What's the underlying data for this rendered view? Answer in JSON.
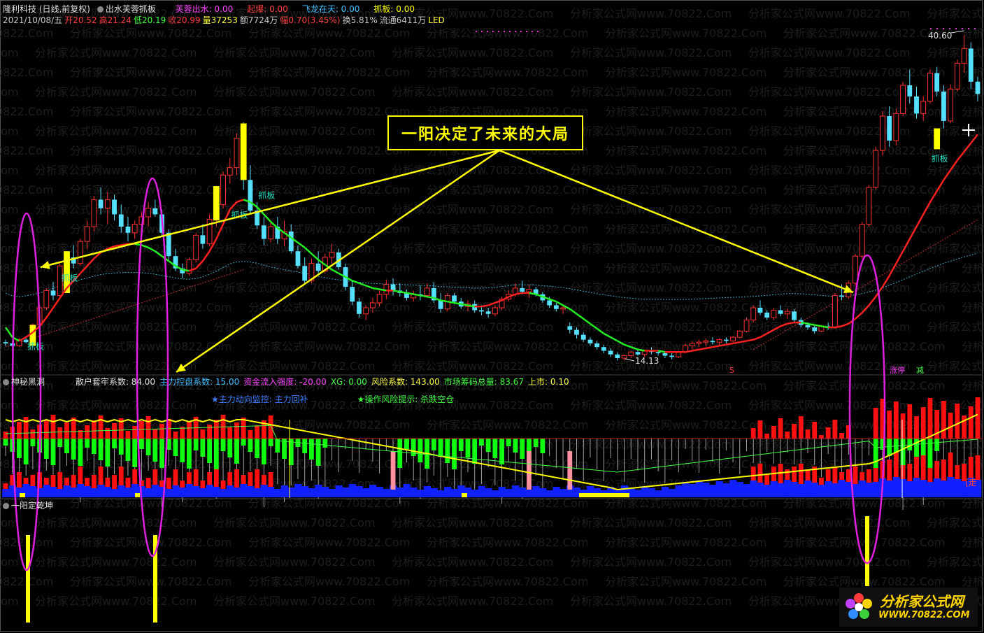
{
  "header": {
    "stock": "隆利科技 (日线,前复权)",
    "indicator": "出水芙蓉抓板",
    "signals": [
      {
        "label": "芙蓉出水: 0.00",
        "color": "#ff44ff"
      },
      {
        "label": "起爆: 0.00",
        "color": "#ff4040"
      },
      {
        "label": "飞龙在天: 0.00",
        "color": "#40c0ff"
      },
      {
        "label": "抓板: 0.00",
        "color": "#ffff00"
      }
    ],
    "quote": [
      {
        "label": "2021/10/08/五",
        "color": "#c8c8c8"
      },
      {
        "label": "开20.52",
        "color": "#ff4040"
      },
      {
        "label": "高21.24",
        "color": "#ff4040"
      },
      {
        "label": "低20.19",
        "color": "#40ff40"
      },
      {
        "label": "收20.99",
        "color": "#ff4040"
      },
      {
        "label": "量37253",
        "color": "#ffff40"
      },
      {
        "label": "额7724万",
        "color": "#c8c8c8"
      },
      {
        "label": "幅0.70(3.45%)",
        "color": "#ff4040"
      },
      {
        "label": "换5.81%",
        "color": "#c8c8c8"
      },
      {
        "label": "流通6411万",
        "color": "#c8c8c8"
      },
      {
        "label": "LED",
        "color": "#ffff40"
      }
    ]
  },
  "main_chart": {
    "high_label": "40.60",
    "low_label": "14.13",
    "zhuaban_label": "抓板",
    "callout": "一阳决定了未来的大局",
    "marker_s": "S",
    "marker_a": "涨停",
    "marker_b": "减"
  },
  "panel2": {
    "title": "神秘黑洞",
    "row1": [
      {
        "label": "散户套牢系数: 84.00",
        "color": "#e0e0e0"
      },
      {
        "label": "主力控盘系数: 15.00",
        "color": "#40c0ff"
      },
      {
        "label": "资金流入强度: -20.00",
        "color": "#ff44ff"
      },
      {
        "label": "XG: 0.00",
        "color": "#40ff40"
      },
      {
        "label": "风险系数: 143.00",
        "color": "#ffff40"
      },
      {
        "label": "市场筹码总量: 83.67",
        "color": "#40ff40"
      },
      {
        "label": "上市: 0.10",
        "color": "#ffff40"
      }
    ],
    "row2": [
      {
        "label": "★主力动向监控: 主力回补",
        "color": "#4080ff"
      },
      {
        "label": "★操作风险提示: 杀跌空仓",
        "color": "#40ff40"
      }
    ],
    "right_tag": "[走"
  },
  "panel3": {
    "title": "一阳定乾坤"
  },
  "watermark": "分析家公式网www.70822.Com",
  "logo": {
    "name": "分析家公式网",
    "url": "WWW.70822.COM"
  },
  "chart_data": {
    "type": "candlestick",
    "title": "隆利科技 (日线,前复权)",
    "ylim": [
      14.13,
      40.6
    ],
    "candles": [
      [
        15.6,
        15.8,
        15.3,
        15.5
      ],
      [
        15.5,
        15.7,
        15.2,
        15.3
      ],
      [
        15.3,
        15.9,
        15.2,
        15.8
      ],
      [
        15.8,
        16.0,
        15.5,
        15.6
      ],
      [
        15.6,
        17.1,
        15.5,
        17.0
      ],
      [
        17.0,
        18.6,
        16.8,
        18.4
      ],
      [
        18.4,
        20.0,
        18.2,
        19.8
      ],
      [
        19.8,
        20.5,
        19.0,
        19.4
      ],
      [
        19.4,
        22.0,
        19.2,
        21.8
      ],
      [
        21.8,
        23.0,
        21.0,
        22.5
      ],
      [
        22.5,
        23.5,
        21.6,
        22.0
      ],
      [
        22.0,
        24.0,
        21.8,
        23.8
      ],
      [
        23.8,
        25.5,
        23.2,
        25.0
      ],
      [
        25.0,
        27.5,
        24.6,
        27.2
      ],
      [
        27.2,
        28.2,
        26.0,
        26.5
      ],
      [
        26.5,
        27.8,
        25.2,
        27.2
      ],
      [
        27.2,
        27.6,
        25.5,
        26.0
      ],
      [
        26.0,
        26.8,
        24.5,
        25.0
      ],
      [
        25.0,
        25.8,
        23.8,
        24.5
      ],
      [
        24.5,
        25.5,
        24.0,
        25.2
      ],
      [
        25.2,
        26.2,
        24.8,
        25.8
      ],
      [
        25.8,
        27.0,
        25.0,
        26.5
      ],
      [
        26.5,
        27.2,
        25.8,
        26.0
      ],
      [
        26.0,
        26.4,
        24.2,
        24.5
      ],
      [
        24.5,
        24.8,
        22.3,
        22.6
      ],
      [
        22.6,
        23.2,
        21.4,
        21.6
      ],
      [
        21.6,
        22.0,
        20.8,
        21.2
      ],
      [
        21.2,
        22.5,
        21.0,
        22.3
      ],
      [
        22.3,
        24.5,
        22.1,
        24.3
      ],
      [
        24.3,
        25.2,
        23.2,
        23.6
      ],
      [
        23.6,
        26.0,
        23.4,
        25.6
      ],
      [
        25.6,
        27.2,
        25.0,
        26.8
      ],
      [
        26.8,
        29.5,
        26.5,
        29.2
      ],
      [
        29.2,
        30.6,
        28.5,
        29.8
      ],
      [
        29.8,
        32.6,
        29.2,
        32.2
      ],
      [
        32.2,
        33.5,
        28.0,
        28.8
      ],
      [
        28.8,
        30.0,
        26.0,
        26.3
      ],
      [
        26.3,
        27.0,
        24.8,
        25.1
      ],
      [
        25.1,
        25.8,
        23.5,
        24.0
      ],
      [
        24.0,
        25.4,
        23.7,
        25.0
      ],
      [
        25.0,
        25.8,
        23.6,
        24.0
      ],
      [
        24.0,
        25.5,
        23.4,
        24.6
      ],
      [
        24.6,
        25.2,
        22.8,
        23.0
      ],
      [
        23.0,
        23.5,
        21.6,
        21.8
      ],
      [
        21.8,
        22.5,
        20.4,
        20.6
      ],
      [
        20.6,
        22.4,
        20.4,
        22.0
      ],
      [
        22.0,
        23.0,
        21.2,
        21.4
      ],
      [
        21.4,
        22.8,
        21.2,
        22.5
      ],
      [
        22.5,
        23.6,
        22.0,
        22.9
      ],
      [
        22.9,
        23.2,
        21.5,
        21.7
      ],
      [
        21.7,
        22.0,
        19.8,
        20.1
      ],
      [
        20.1,
        20.6,
        18.6,
        18.9
      ],
      [
        18.9,
        19.2,
        17.6,
        17.9
      ],
      [
        17.9,
        18.6,
        17.4,
        18.4
      ],
      [
        18.4,
        19.2,
        18.0,
        18.8
      ],
      [
        18.8,
        19.9,
        18.5,
        19.5
      ],
      [
        19.5,
        20.7,
        19.1,
        20.3
      ],
      [
        20.3,
        20.8,
        19.4,
        19.8
      ],
      [
        19.8,
        20.4,
        19.3,
        19.6
      ],
      [
        19.6,
        19.9,
        19.0,
        19.2
      ],
      [
        19.2,
        19.8,
        18.9,
        19.5
      ],
      [
        19.5,
        20.2,
        19.0,
        19.4
      ],
      [
        19.4,
        20.4,
        19.2,
        20.0
      ],
      [
        20.0,
        20.5,
        18.8,
        19.0
      ],
      [
        19.0,
        19.6,
        18.0,
        18.3
      ],
      [
        18.3,
        19.6,
        18.1,
        19.4
      ],
      [
        19.4,
        19.6,
        18.7,
        18.9
      ],
      [
        18.9,
        19.2,
        18.3,
        18.5
      ],
      [
        18.5,
        19.0,
        18.1,
        18.7
      ],
      [
        18.7,
        19.0,
        18.0,
        18.2
      ],
      [
        18.2,
        18.6,
        17.8,
        18.1
      ],
      [
        18.1,
        18.4,
        17.6,
        17.9
      ],
      [
        17.9,
        18.6,
        17.7,
        18.4
      ],
      [
        18.4,
        19.3,
        18.2,
        19.1
      ],
      [
        19.1,
        19.8,
        18.9,
        19.5
      ],
      [
        19.5,
        20.4,
        19.3,
        20.0
      ],
      [
        20.0,
        20.6,
        19.5,
        19.7
      ],
      [
        19.7,
        20.3,
        19.2,
        19.9
      ],
      [
        19.9,
        20.1,
        19.3,
        19.5
      ],
      [
        19.5,
        19.7,
        18.8,
        19.0
      ],
      [
        19.0,
        19.3,
        18.4,
        18.6
      ],
      [
        18.6,
        18.8,
        18.1,
        18.3
      ],
      [
        18.3,
        18.7,
        17.9,
        18.4
      ],
      [
        16.9,
        17.2,
        16.3,
        16.6
      ],
      [
        16.6,
        16.8,
        15.9,
        16.2
      ],
      [
        16.2,
        16.4,
        15.6,
        15.8
      ],
      [
        15.8,
        16.0,
        15.3,
        15.5
      ],
      [
        15.5,
        15.7,
        15.0,
        15.2
      ],
      [
        15.2,
        15.4,
        14.7,
        14.9
      ],
      [
        14.9,
        15.1,
        14.4,
        14.6
      ],
      [
        14.6,
        14.8,
        14.1,
        14.3
      ],
      [
        14.3,
        14.6,
        14.13,
        14.5
      ],
      [
        14.5,
        14.9,
        14.3,
        14.8
      ],
      [
        14.8,
        15.1,
        14.5,
        14.6
      ],
      [
        14.6,
        15.0,
        14.4,
        14.9
      ],
      [
        14.9,
        15.2,
        14.6,
        14.8
      ],
      [
        14.8,
        14.9,
        14.5,
        14.7
      ],
      [
        14.7,
        14.8,
        14.3,
        14.5
      ],
      [
        14.5,
        14.7,
        14.2,
        14.4
      ],
      [
        14.4,
        14.9,
        14.3,
        14.8
      ],
      [
        14.8,
        15.5,
        14.7,
        15.3
      ],
      [
        15.3,
        15.7,
        15.0,
        15.5
      ],
      [
        15.5,
        15.8,
        15.2,
        15.6
      ],
      [
        15.6,
        15.9,
        15.3,
        15.7
      ],
      [
        15.7,
        16.0,
        15.4,
        15.6
      ],
      [
        15.6,
        15.9,
        15.3,
        15.8
      ],
      [
        15.8,
        16.0,
        15.5,
        15.7
      ],
      [
        15.7,
        16.1,
        15.6,
        16.0
      ],
      [
        16.0,
        16.6,
        15.9,
        16.5
      ],
      [
        16.5,
        17.6,
        16.4,
        17.4
      ],
      [
        17.4,
        18.6,
        17.2,
        18.4
      ],
      [
        18.4,
        19.0,
        17.8,
        18.0
      ],
      [
        18.0,
        18.2,
        17.4,
        17.6
      ],
      [
        17.6,
        18.4,
        17.4,
        18.2
      ],
      [
        18.2,
        18.6,
        17.7,
        17.9
      ],
      [
        17.9,
        18.3,
        17.5,
        18.1
      ],
      [
        18.1,
        18.3,
        17.2,
        17.4
      ],
      [
        17.4,
        17.6,
        16.8,
        17.0
      ],
      [
        17.0,
        17.2,
        16.6,
        16.8
      ],
      [
        16.8,
        17.0,
        16.3,
        16.5
      ],
      [
        16.5,
        17.0,
        16.4,
        16.9
      ],
      [
        16.9,
        17.2,
        16.6,
        16.8
      ],
      [
        16.8,
        19.6,
        16.7,
        19.4
      ],
      [
        19.4,
        20.3,
        19.0,
        19.3
      ],
      [
        19.3,
        20.6,
        19.1,
        20.4
      ],
      [
        20.4,
        22.8,
        20.2,
        22.6
      ],
      [
        22.6,
        25.4,
        22.4,
        25.2
      ],
      [
        25.2,
        28.4,
        25.0,
        28.2
      ],
      [
        28.2,
        31.5,
        28.0,
        31.2
      ],
      [
        31.2,
        34.4,
        30.8,
        34.0
      ],
      [
        34.0,
        34.8,
        31.5,
        32.0
      ],
      [
        32.0,
        34.6,
        31.6,
        34.2
      ],
      [
        34.2,
        36.8,
        34.0,
        36.5
      ],
      [
        36.5,
        37.8,
        35.0,
        35.6
      ],
      [
        35.6,
        36.4,
        33.8,
        34.2
      ],
      [
        34.2,
        35.6,
        33.6,
        35.2
      ],
      [
        35.2,
        37.8,
        35.0,
        37.5
      ],
      [
        37.5,
        38.0,
        35.6,
        36.0
      ],
      [
        36.0,
        36.5,
        33.0,
        33.6
      ],
      [
        33.6,
        36.6,
        33.4,
        36.2
      ],
      [
        36.2,
        38.6,
        36.0,
        38.3
      ],
      [
        38.3,
        40.6,
        37.5,
        39.5
      ],
      [
        39.5,
        40.0,
        36.2,
        36.8
      ],
      [
        36.8,
        37.2,
        35.2,
        35.8
      ]
    ],
    "ma_short": [
      16.8,
      16.0,
      15.7,
      16.0,
      16.4,
      16.9,
      17.6,
      18.4,
      19.2,
      20.0,
      20.6,
      21.2,
      21.8,
      22.4,
      22.9,
      23.2,
      23.4,
      23.5,
      23.6,
      23.6,
      23.5,
      23.3,
      23.0,
      22.6,
      22.2,
      21.8,
      21.5,
      21.4,
      21.6,
      22.2,
      23.0,
      24.0,
      25.2,
      26.4,
      27.0,
      27.2,
      27.0,
      26.6,
      26.0,
      25.4,
      24.9,
      24.5,
      24.1,
      23.7,
      23.3,
      22.8,
      22.3,
      21.9,
      21.5,
      21.2,
      20.9,
      20.6,
      20.4,
      20.2,
      20.0,
      19.9,
      19.8,
      19.8,
      19.7,
      19.6,
      19.5,
      19.4,
      19.3,
      19.2,
      19.0,
      18.9,
      18.8,
      18.7,
      18.6,
      18.5,
      18.5,
      18.6,
      18.8,
      19.0,
      19.3,
      19.5,
      19.6,
      19.6,
      19.5,
      19.3,
      19.1,
      18.9,
      18.6,
      18.3,
      17.9,
      17.5,
      17.1,
      16.7,
      16.3,
      16.0,
      15.7,
      15.4,
      15.2,
      15.0,
      14.9,
      14.9,
      14.9,
      14.8,
      14.8,
      14.8,
      14.8,
      14.9,
      15.0,
      15.1,
      15.2,
      15.3,
      15.4,
      15.5,
      15.6,
      15.7,
      15.8,
      16.0,
      16.3,
      16.6,
      16.9,
      17.1,
      17.2,
      17.2,
      17.1,
      17.0,
      16.9,
      16.8,
      16.8,
      16.9,
      17.1,
      17.5,
      18.0,
      18.6,
      19.3,
      20.1,
      21.0,
      22.0,
      23.0,
      24.0,
      25.0,
      26.0,
      27.0,
      27.9,
      28.8,
      29.6,
      30.4,
      31.1,
      31.8,
      32.5
    ]
  }
}
